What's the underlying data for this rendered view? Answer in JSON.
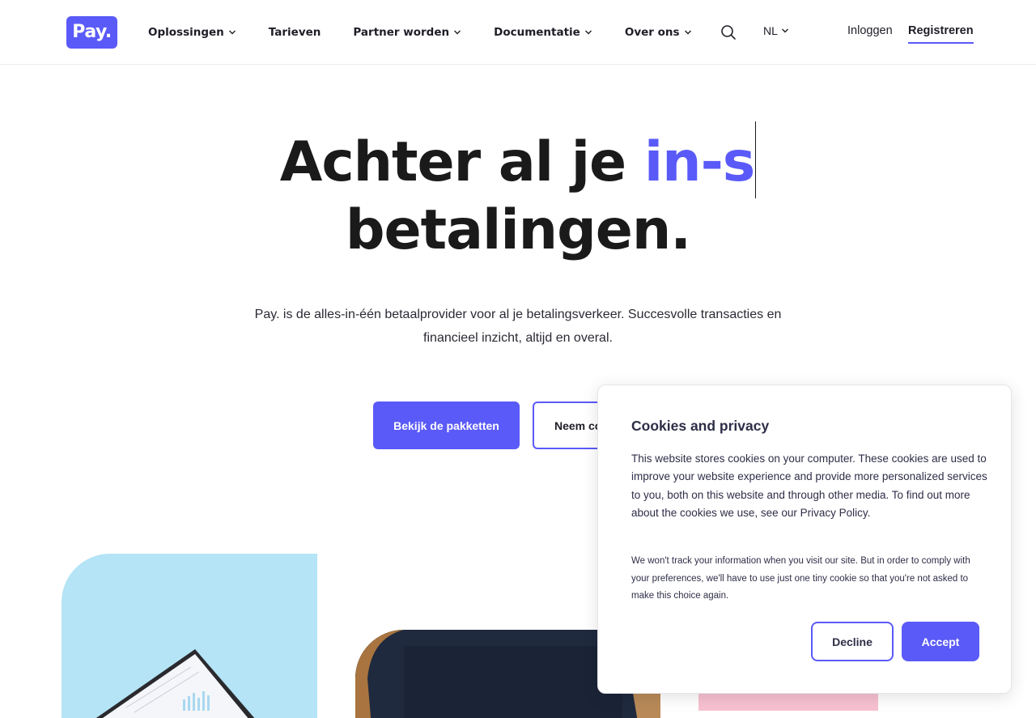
{
  "header": {
    "logo_text": "Pay.",
    "nav": [
      {
        "label": "Oplossingen",
        "has_dropdown": true
      },
      {
        "label": "Tarieven",
        "has_dropdown": false
      },
      {
        "label": "Partner worden",
        "has_dropdown": true
      },
      {
        "label": "Documentatie",
        "has_dropdown": true
      },
      {
        "label": "Over ons",
        "has_dropdown": true
      }
    ],
    "search_icon": "search-icon",
    "language": "NL",
    "login_label": "Inloggen",
    "register_label": "Registreren"
  },
  "hero": {
    "title_prefix": "Achter al je ",
    "title_typed": "in-s",
    "title_line2": "betalingen.",
    "subtitle": "Pay. is de alles-in-één betaalprovider voor al je betalingsverkeer. Succesvolle transacties en financieel inzicht, altijd en overal.",
    "primary_button": "Bekijk de pakketten",
    "secondary_button": "Neem contact op"
  },
  "cookie_banner": {
    "title": "Cookies and privacy",
    "text": "This website stores cookies on your computer. These cookies are used to improve your website experience and provide more personalized services to you, both on this website and through other media. To find out more about the cookies we use, see our Privacy Policy.",
    "small_text": "We won't track your information when you visit our site. But in order to comply with your preferences, we'll have to use just one tiny cookie so that you're not asked to make this choice again.",
    "decline_label": "Decline",
    "accept_label": "Accept"
  },
  "colors": {
    "accent": "#5a5af8",
    "text": "#1a1a1a",
    "card_blue": "#b4e4f6",
    "card_pink": "#f7c1d1"
  }
}
